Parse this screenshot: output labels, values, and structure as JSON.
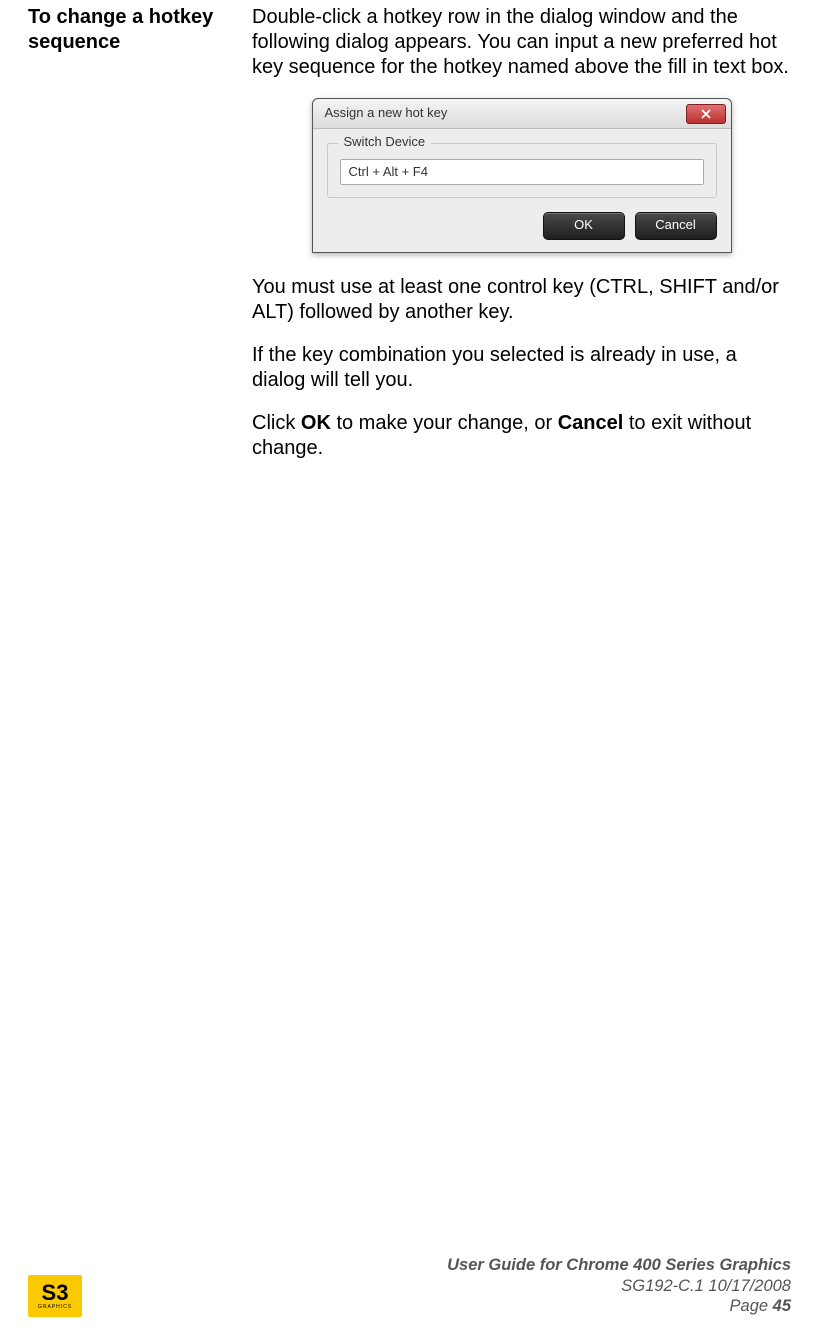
{
  "left": {
    "heading": "To change a hotkey sequence"
  },
  "body": {
    "p1": "Double-click a hotkey row in the dialog window and the following dialog appears. You can input a new preferred hot key sequence for the hotkey named above the fill in text box.",
    "p2": "You must use at least one control key (CTRL, SHIFT and/or ALT) followed by another key.",
    "p3": "If the key combination you selected is already in use, a dialog will tell you.",
    "p4_pre": "Click ",
    "p4_b1": "OK",
    "p4_mid": " to make your change, or ",
    "p4_b2": "Cancel",
    "p4_post": " to exit without change."
  },
  "dialog": {
    "title": "Assign a new hot key",
    "group_label": "Switch Device",
    "input_value": "Ctrl + Alt + F4",
    "ok_label": "OK",
    "cancel_label": "Cancel"
  },
  "footer": {
    "title": "User Guide for Chrome 400 Series Graphics",
    "docid_date": "SG192-C.1   10/17/2008",
    "page_label": "Page ",
    "page_num": "45",
    "logo_main": "S3",
    "logo_sub": "GRAPHICS"
  }
}
